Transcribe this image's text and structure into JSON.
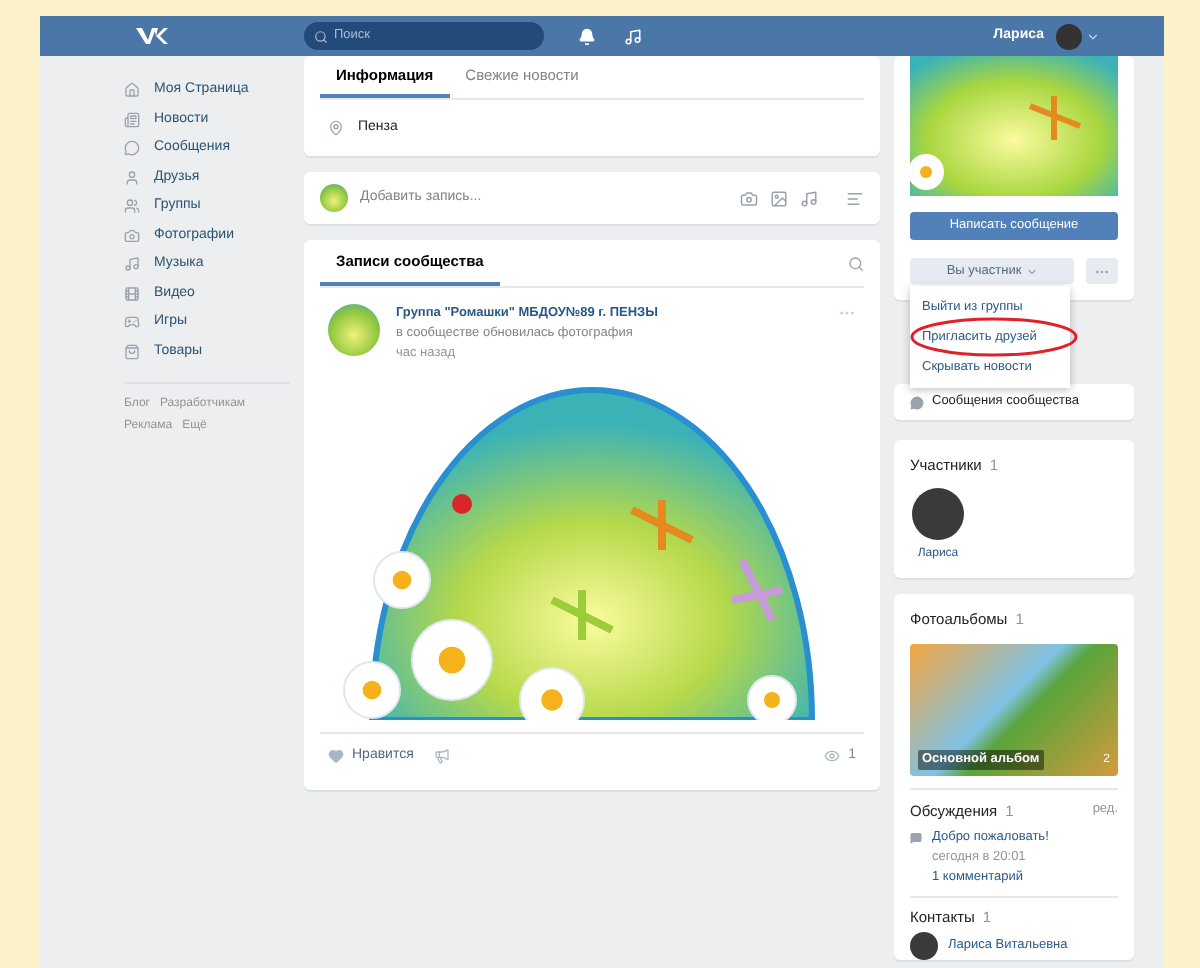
{
  "header": {
    "search_placeholder": "Поиск",
    "user_name": "Лариса"
  },
  "sidebar": {
    "items": [
      {
        "label": "Моя Страница"
      },
      {
        "label": "Новости"
      },
      {
        "label": "Сообщения"
      },
      {
        "label": "Друзья"
      },
      {
        "label": "Группы"
      },
      {
        "label": "Фотографии"
      },
      {
        "label": "Музыка"
      },
      {
        "label": "Видео"
      },
      {
        "label": "Игры"
      },
      {
        "label": "Товары"
      }
    ],
    "footer_links": [
      "Блог",
      "Разработчикам",
      "Реклама",
      "Ещё"
    ]
  },
  "info_card": {
    "tabs": [
      {
        "label": "Информация",
        "selected": true
      },
      {
        "label": "Свежие новости",
        "selected": false
      }
    ],
    "location": "Пенза"
  },
  "composer": {
    "placeholder": "Добавить запись..."
  },
  "wall": {
    "tabs": [
      {
        "label": "Записи сообщества",
        "selected": true
      }
    ],
    "post": {
      "author": "Группа \"Ромашки\" МБДОУ№89 г. ПЕНЗЫ",
      "action": "в сообществе обновилась фотография",
      "time": "час назад",
      "like_label": "Нравится",
      "views": "1"
    }
  },
  "actions": {
    "message_button": "Написать сообщение",
    "member_button": "Вы участник",
    "menu": [
      {
        "label": "Выйти из группы",
        "highlighted": false
      },
      {
        "label": "Пригласить друзей",
        "highlighted": true
      },
      {
        "label": "Скрывать новости",
        "highlighted": false
      }
    ]
  },
  "community_messages": "Сообщения сообщества",
  "members": {
    "title": "Участники",
    "count": "1",
    "items": [
      {
        "name": "Лариса"
      }
    ]
  },
  "albums": {
    "title": "Фотоальбомы",
    "count": "1",
    "items": [
      {
        "name": "Основной альбом",
        "count": "2"
      }
    ]
  },
  "discussions": {
    "title": "Обсуждения",
    "count": "1",
    "edit_link": "ред.",
    "items": [
      {
        "title": "Добро пожаловать!",
        "time": "сегодня в 20:01",
        "comments": "1 комментарий"
      }
    ]
  },
  "contacts": {
    "title": "Контакты",
    "count": "1",
    "items": [
      {
        "name": "Лариса Витальевна"
      }
    ]
  }
}
